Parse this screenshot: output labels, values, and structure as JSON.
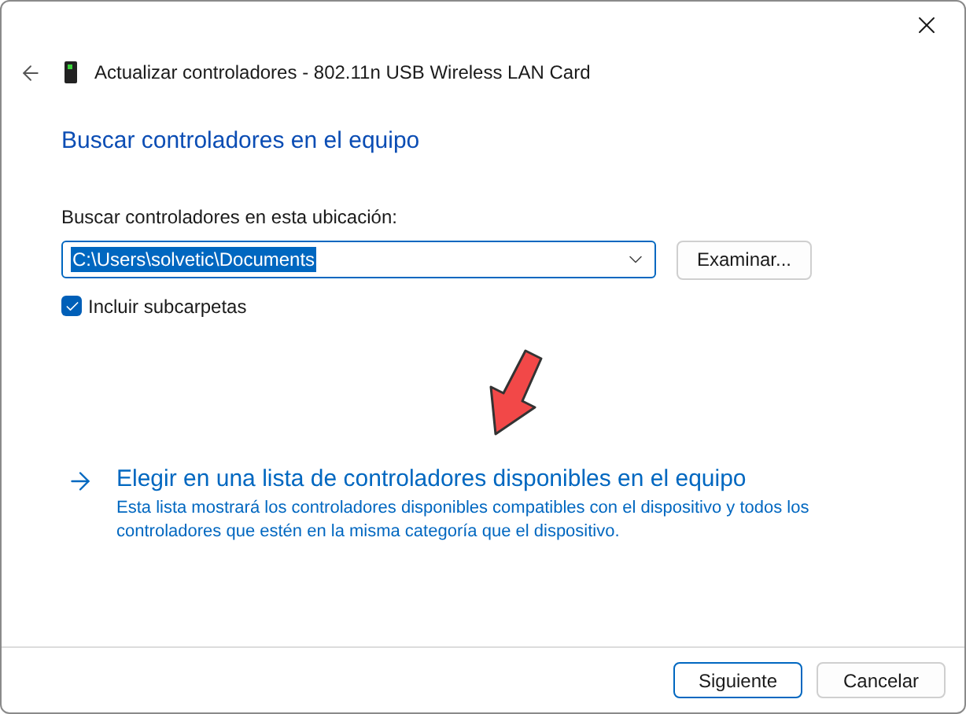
{
  "window": {
    "title": "Actualizar controladores - 802.11n USB Wireless LAN Card"
  },
  "heading": "Buscar controladores en el equipo",
  "location": {
    "label": "Buscar controladores en esta ubicación:",
    "value": "C:\\Users\\solvetic\\Documents",
    "browse_button": "Examinar..."
  },
  "include_subfolders": {
    "label": "Incluir subcarpetas",
    "checked": true
  },
  "choose_link": {
    "title": "Elegir en una lista de controladores disponibles en el equipo",
    "description": "Esta lista mostrará los controladores disponibles compatibles con el dispositivo y todos los controladores que estén en la misma categoría que el dispositivo."
  },
  "buttons": [
    {
      "label": "Siguiente",
      "selected": true
    },
    {
      "label": "Cancelar",
      "selected": false
    }
  ]
}
